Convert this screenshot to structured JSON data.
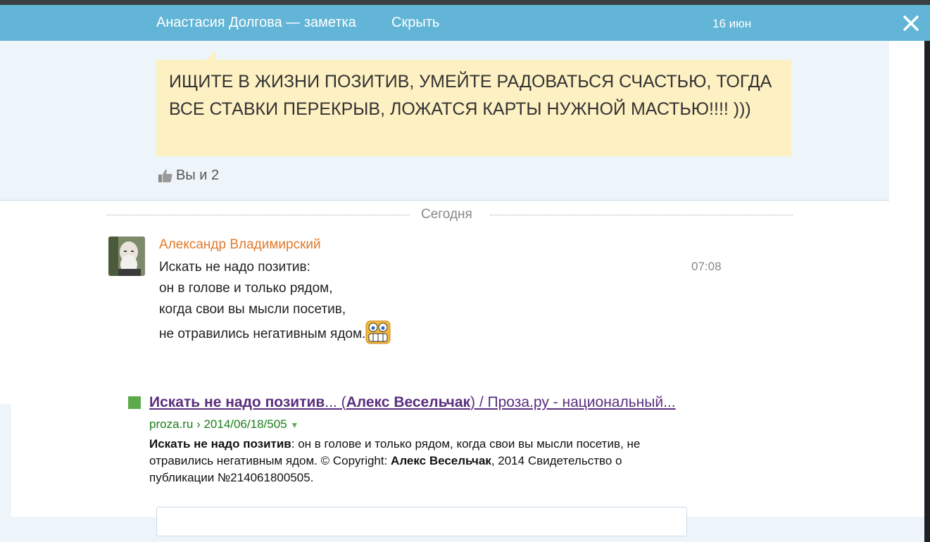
{
  "header": {
    "title": "Анастасия Долгова — заметка",
    "hide_label": "Скрыть",
    "date": "16 июн",
    "close_icon": "close-icon"
  },
  "note": {
    "text": "ИЩИТЕ В ЖИЗНИ ПОЗИТИВ, УМЕЙТЕ РАДОВАТЬСЯ СЧАСТЬЮ, ТОГДА ВСЕ СТАВКИ ПЕРЕКРЫВ, ЛОЖАТСЯ КАРТЫ НУЖНОЙ МАСТЬЮ!!!! )))",
    "likes": "Вы и 2",
    "likes_icon": "thumbs-up-icon"
  },
  "day_separator": "Сегодня",
  "message": {
    "author": "Александр Владимирский",
    "time": "07:08",
    "lines": [
      "Искать не надо позитив:",
      "он в голове и только рядом,",
      "когда свои вы мысли посетив,",
      "не отравились негативным ядом."
    ],
    "emoji": "grinning-smiley-icon"
  },
  "search_result": {
    "title_part1": "Искать",
    "title_sep1": " ",
    "title_part2": "не",
    "title_part3": "надо",
    "title_part4": "позитив",
    "title_mid": "... (",
    "title_part5": "Алекс",
    "title_part6": "Весельчак",
    "title_tail": ") / Проза.ру - национальный...",
    "url": "proza.ru › 2014/06/18/505",
    "snippet_bold1": "Искать не надо позитив",
    "snippet_text1": ": он в голове и только рядом, когда свои вы мысли посетив, не отравились негативным ядом. © Copyright: ",
    "snippet_bold2": "Алекс Весельчак",
    "snippet_text2": ", 2014 Свидетельство о публикации №214061800505."
  },
  "colors": {
    "header_bg": "#62b5d6",
    "note_bg": "#fdf0c2",
    "author": "#e07a2a",
    "link_visited": "#5a2f7e",
    "url_green": "#1a7f1a"
  }
}
